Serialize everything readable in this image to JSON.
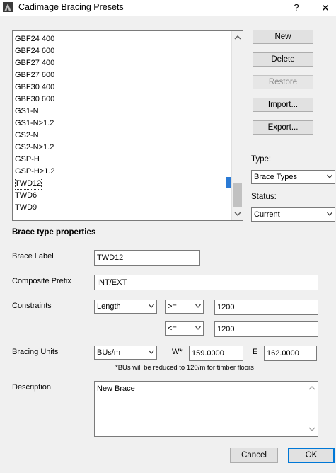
{
  "window": {
    "title": "Cadimage Bracing Presets",
    "help_label": "?",
    "close_label": "✕"
  },
  "presets_list": {
    "items": [
      "GBF24 400",
      "GBF24 600",
      "GBF27 400",
      "GBF27 600",
      "GBF30 400",
      "GBF30 600",
      "GS1-N",
      "GS1-N>1.2",
      "GS2-N",
      "GS2-N>1.2",
      "GSP-H",
      "GSP-H>1.2",
      "TWD12",
      "TWD6",
      "TWD9"
    ],
    "selected": "TWD12"
  },
  "actions": {
    "new": "New",
    "delete": "Delete",
    "restore": "Restore",
    "import": "Import...",
    "export": "Export..."
  },
  "filters": {
    "type_label": "Type:",
    "type_value": "Brace Types",
    "status_label": "Status:",
    "status_value": "Current"
  },
  "properties": {
    "heading": "Brace type properties",
    "brace_label_label": "Brace Label",
    "brace_label_value": "TWD12",
    "composite_prefix_label": "Composite Prefix",
    "composite_prefix_value": "INT/EXT",
    "constraints_label": "Constraints",
    "constraint_field": "Length",
    "constraint1_op": ">=",
    "constraint1_value": "1200",
    "constraint2_op": "<=",
    "constraint2_value": "1200",
    "bracing_units_label": "Bracing Units",
    "bracing_units_value": "BUs/m",
    "w_label": "W*",
    "w_value": "159.0000",
    "e_label": "E",
    "e_value": "162.0000",
    "note": "*BUs will be reduced to 120/m for timber floors",
    "description_label": "Description",
    "description_value": "New Brace"
  },
  "footer": {
    "cancel": "Cancel",
    "ok": "OK"
  },
  "colors": {
    "selection_marker": "#2a7ad5",
    "default_button_border": "#0078d7"
  }
}
